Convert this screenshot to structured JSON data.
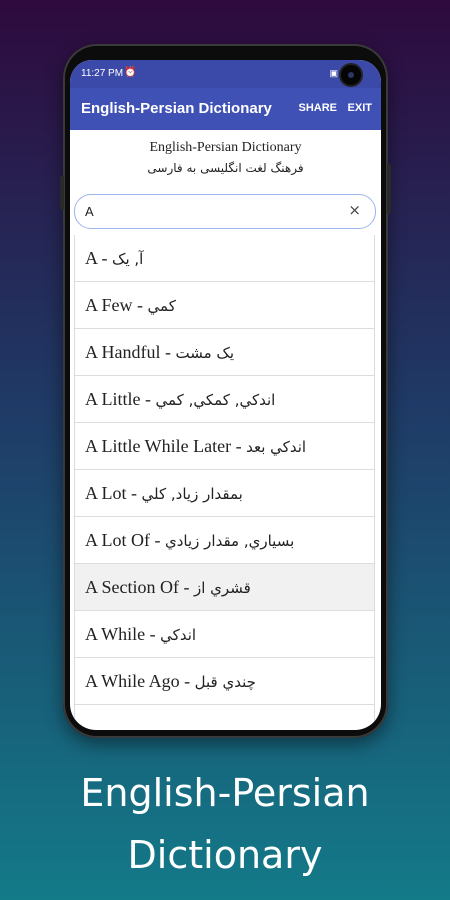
{
  "statusbar": {
    "time": "11:27 PM",
    "alarm_icon": "alarm-icon"
  },
  "appbar": {
    "title": "English-Persian Dictionary",
    "share_label": "SHARE",
    "exit_label": "EXIT"
  },
  "header": {
    "english": "English-Persian Dictionary",
    "persian": "فرهنگ لغت انگلیسی به فارسی"
  },
  "search": {
    "value": "A",
    "clear_icon": "×"
  },
  "entries": [
    {
      "en": "A",
      "fa": "آ, یک"
    },
    {
      "en": "A Few",
      "fa": "کمي"
    },
    {
      "en": "A Handful",
      "fa": "یک مشت"
    },
    {
      "en": "A Little",
      "fa": "اندکي, کمکي, کمي"
    },
    {
      "en": "A Little While Later",
      "fa": "اندکي بعد"
    },
    {
      "en": "A Lot",
      "fa": "بمقدار زياد, کلي"
    },
    {
      "en": "A Lot Of",
      "fa": "بسياري, مقدار زيادي"
    },
    {
      "en": "A Section Of",
      "fa": "قشري از"
    },
    {
      "en": "A While",
      "fa": "اندکي"
    },
    {
      "en": "A While Ago",
      "fa": "چندي قبل"
    }
  ],
  "highlighted_index": 7,
  "caption": {
    "line1": "English-Persian",
    "line2": "Dictionary"
  },
  "colors": {
    "appbar": "#3f51b5",
    "statusbar": "#3b4aa8",
    "search_border": "#9bb6ee",
    "highlight_row": "#f1f1f1"
  }
}
